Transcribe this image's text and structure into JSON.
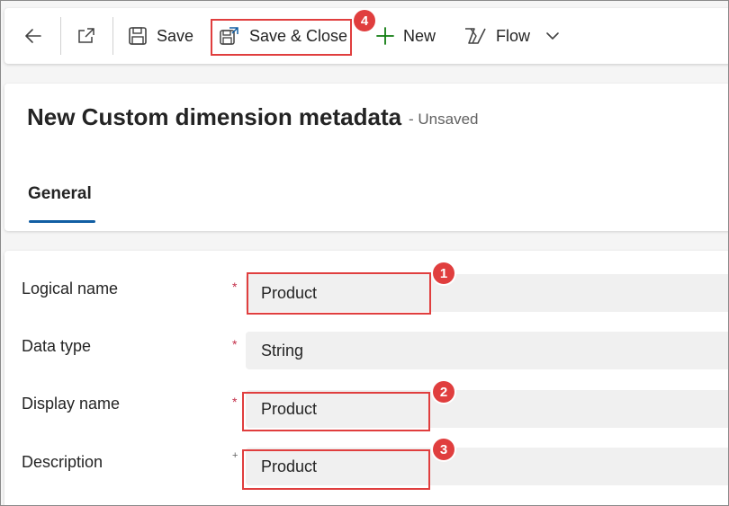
{
  "toolbar": {
    "back_icon": "arrow-left-icon",
    "open_new_window_icon": "open-in-new-window-icon",
    "save_label": "Save",
    "save_close_label": "Save & Close",
    "new_label": "New",
    "flow_label": "Flow"
  },
  "header": {
    "title": "New Custom dimension metadata",
    "status": "- Unsaved"
  },
  "tabs": [
    {
      "label": "General",
      "selected": true
    }
  ],
  "form": {
    "fields": [
      {
        "label": "Logical name",
        "value": "Product",
        "required": true,
        "required_mark": "*"
      },
      {
        "label": "Data type",
        "value": "String",
        "required": true,
        "required_mark": "*"
      },
      {
        "label": "Display name",
        "value": "Product",
        "required": true,
        "required_mark": "*"
      },
      {
        "label": "Description",
        "value": "Product",
        "required": false,
        "required_mark": "+"
      }
    ]
  },
  "annotations": {
    "badge_1": "1",
    "badge_2": "2",
    "badge_3": "3",
    "badge_4": "4"
  },
  "colors": {
    "accent": "#115ea3",
    "annotation": "#e03e3e",
    "new_icon": "#107c10",
    "required": "#c4314b"
  }
}
